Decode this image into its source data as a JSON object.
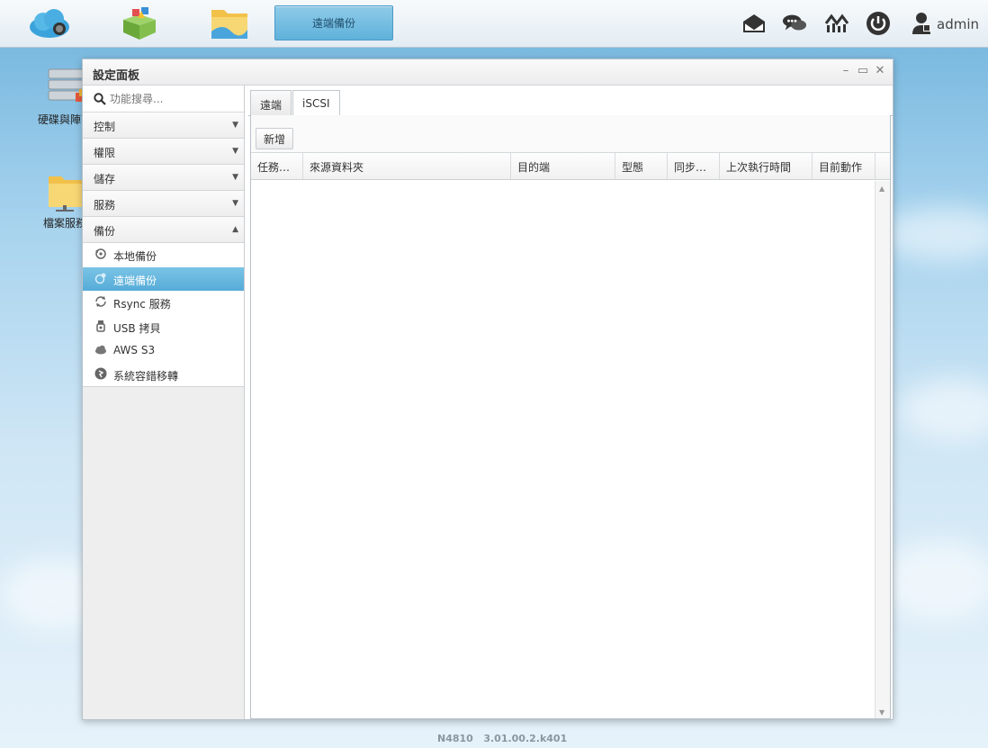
{
  "taskbar": {
    "active_task_label": "遠端備份",
    "user_label": "admin"
  },
  "desktop": {
    "icons": [
      {
        "label": "硬碟與陣列"
      },
      {
        "label": "檔案服務"
      }
    ]
  },
  "window": {
    "title": "設定面板",
    "search_placeholder": "功能搜尋...",
    "categories": [
      {
        "label": "控制",
        "arrow": "▼"
      },
      {
        "label": "權限",
        "arrow": "▼"
      },
      {
        "label": "儲存",
        "arrow": "▼"
      },
      {
        "label": "服務",
        "arrow": "▼"
      },
      {
        "label": "備份",
        "arrow": "▲"
      }
    ],
    "backup_items": [
      {
        "label": "本地備份",
        "icon": "local-backup-icon"
      },
      {
        "label": "遠端備份",
        "icon": "remote-backup-icon"
      },
      {
        "label": "Rsync 服務",
        "icon": "rsync-icon"
      },
      {
        "label": "USB 拷貝",
        "icon": "usb-icon"
      },
      {
        "label": "AWS S3",
        "icon": "cloud-icon"
      },
      {
        "label": "系統容錯移轉",
        "icon": "failover-icon"
      }
    ],
    "tabs": [
      {
        "label": "遠端"
      },
      {
        "label": "iSCSI"
      }
    ],
    "toolbar": {
      "add_label": "新增"
    },
    "columns": [
      "任務…",
      "來源資料夾",
      "目的端",
      "型態",
      "同步…",
      "上次執行時間",
      "目前動作"
    ]
  },
  "footer": {
    "model": "N4810",
    "version": "3.01.00.2.k401"
  },
  "colors": {
    "accent": "#5fb1db",
    "active_item": "#55acd8"
  }
}
